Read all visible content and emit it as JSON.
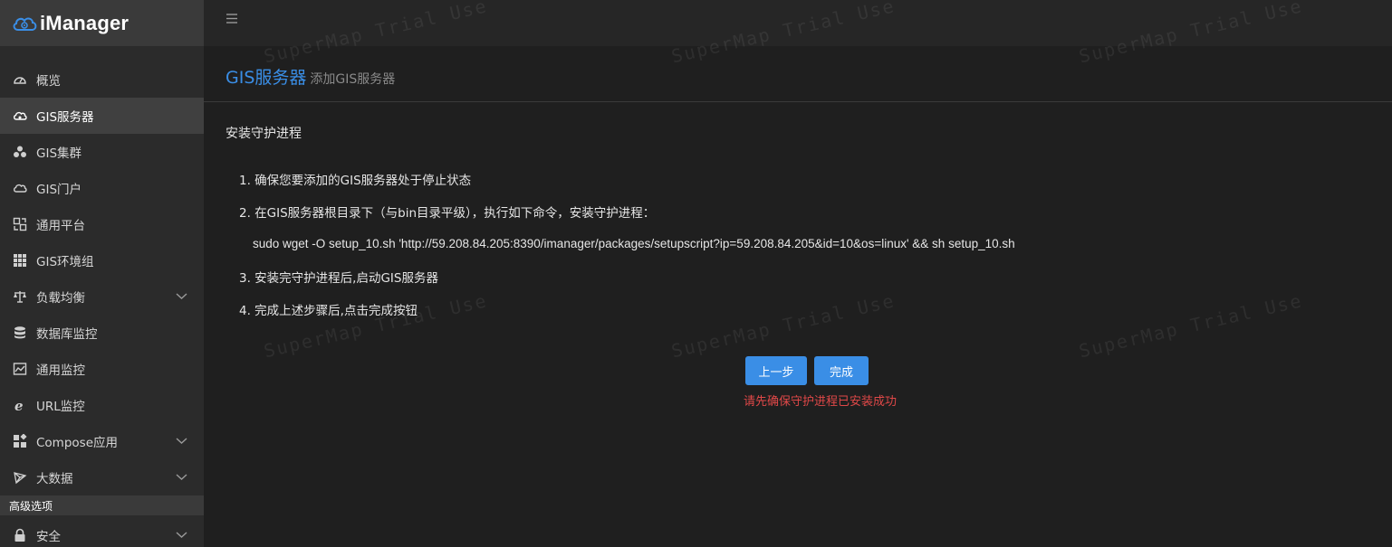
{
  "app": {
    "name": "iManager"
  },
  "sidebar": {
    "items": [
      {
        "label": "概览",
        "icon": "dashboard-icon"
      },
      {
        "label": "GIS服务器",
        "icon": "cloud-icon",
        "active": true
      },
      {
        "label": "GIS集群",
        "icon": "cluster-icon"
      },
      {
        "label": "GIS门户",
        "icon": "cloud-outline-icon"
      },
      {
        "label": "通用平台",
        "icon": "platform-icon"
      },
      {
        "label": "GIS环境组",
        "icon": "grid-icon"
      },
      {
        "label": "负载均衡",
        "icon": "balance-icon",
        "expandable": true
      },
      {
        "label": "数据库监控",
        "icon": "database-icon"
      },
      {
        "label": "通用监控",
        "icon": "chart-icon"
      },
      {
        "label": "URL监控",
        "icon": "ie-icon"
      },
      {
        "label": "Compose应用",
        "icon": "apps-icon",
        "expandable": true
      },
      {
        "label": "大数据",
        "icon": "bigdata-icon",
        "expandable": true
      }
    ],
    "section_label": "高级选项",
    "advanced_items": [
      {
        "label": "安全",
        "icon": "lock-icon",
        "expandable": true
      }
    ]
  },
  "header": {
    "title": "GIS服务器",
    "subtitle": "添加GIS服务器"
  },
  "content": {
    "section_title": "安装守护进程",
    "steps": [
      "1. 确保您要添加的GIS服务器处于停止状态",
      "2. 在GIS服务器根目录下（与bin目录平级），执行如下命令，安装守护进程：",
      "3. 安装完守护进程后,启动GIS服务器",
      "4. 完成上述步骤后,点击完成按钮"
    ],
    "command": "sudo wget -O setup_10.sh 'http://59.208.84.205:8390/imanager/packages/setupscript?ip=59.208.84.205&id=10&os=linux' && sh setup_10.sh",
    "prev_button": "上一步",
    "done_button": "完成",
    "error": "请先确保守护进程已安装成功"
  },
  "watermark": "SuperMap Trial Use",
  "colors": {
    "accent": "#3a8ee6",
    "error": "#e04848"
  }
}
